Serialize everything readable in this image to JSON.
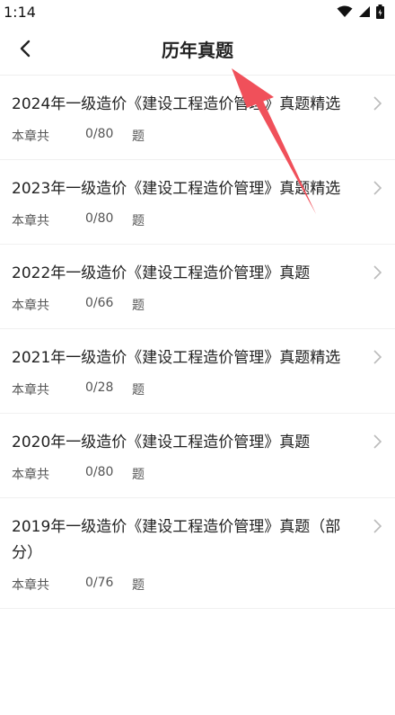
{
  "status_bar": {
    "time": "1:14",
    "icons": [
      "wifi-icon",
      "signal-icon",
      "battery-icon"
    ]
  },
  "header": {
    "title": "历年真题",
    "back_icon": "chevron-left-icon"
  },
  "items": [
    {
      "title": "2024年一级造价《建设工程造价管理》真题精选",
      "label": "本章共",
      "count": "0/80",
      "unit": "题"
    },
    {
      "title": "2023年一级造价《建设工程造价管理》真题精选",
      "label": "本章共",
      "count": "0/80",
      "unit": "题"
    },
    {
      "title": "2022年一级造价《建设工程造价管理》真题",
      "label": "本章共",
      "count": "0/66",
      "unit": "题"
    },
    {
      "title": "2021年一级造价《建设工程造价管理》真题精选",
      "label": "本章共",
      "count": "0/28",
      "unit": "题"
    },
    {
      "title": "2020年一级造价《建设工程造价管理》真题",
      "label": "本章共",
      "count": "0/80",
      "unit": "题"
    },
    {
      "title": "2019年一级造价《建设工程造价管理》真题（部分）",
      "label": "本章共",
      "count": "0/76",
      "unit": "题"
    }
  ],
  "colors": {
    "annotation_arrow": "#f0505a",
    "divider": "#f0f0f0",
    "chevron": "#bbbbbb"
  }
}
